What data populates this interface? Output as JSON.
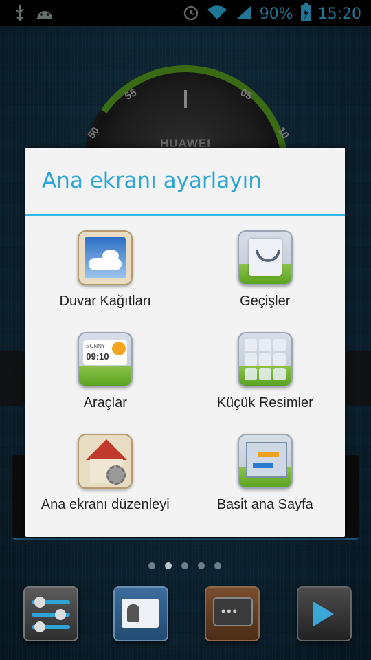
{
  "status_bar": {
    "battery_percent": "90%",
    "time": "15:20",
    "icons": [
      "usb-icon",
      "android-debug-icon",
      "alarm-icon",
      "wifi-icon",
      "signal-icon",
      "battery-charging-icon"
    ]
  },
  "background": {
    "clock_brand": "HUAWEI",
    "clock_numbers": [
      "55",
      "05",
      "50",
      "10"
    ]
  },
  "dialog": {
    "title": "Ana ekranı ayarlayın",
    "options": [
      {
        "label": "Duvar Kağıtları",
        "icon": "wallpaper-icon"
      },
      {
        "label": "Geçişler",
        "icon": "transitions-icon"
      },
      {
        "label": "Araçlar",
        "icon": "widgets-icon",
        "icon_text_day": "SUNNY",
        "icon_text_time": "09:10"
      },
      {
        "label": "Küçük Resimler",
        "icon": "thumbnails-icon"
      },
      {
        "label": "Ana ekranı düzenleyi",
        "icon": "edit-home-icon"
      },
      {
        "label": "Basit ana Sayfa",
        "icon": "simple-home-icon"
      }
    ]
  },
  "page_indicator": {
    "count": 5,
    "active_index": 1
  },
  "dock": {
    "apps": [
      "settings-icon",
      "contacts-icon",
      "messages-icon",
      "play-store-icon"
    ]
  },
  "colors": {
    "accent": "#33b5e5",
    "dialog_bg": "#f3f3f3"
  }
}
